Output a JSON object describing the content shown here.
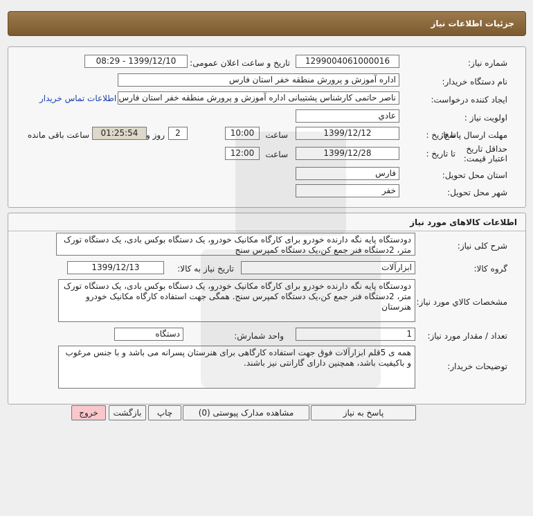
{
  "header": {
    "title": "جزئیات اطلاعات نیاز"
  },
  "need_info": {
    "need_number_label": "شماره نیاز:",
    "need_number": "1299004061000016",
    "announce_label": "تاریخ و ساعت اعلان عمومی:",
    "announce_value": "1399/12/10 - 08:29",
    "buyer_label": "نام دستگاه خریدار:",
    "buyer_value": "اداره آموزش و پرورش منطقه خفر استان فارس",
    "requester_label": "ایجاد کننده درخواست:",
    "requester_value": "ناصر  حاتمی کارشناس پشتیبانی اداره آموزش و پرورش منطقه خفر استان فارس",
    "contact_link": "اطلاعات تماس خریدار",
    "priority_label": "اولویت نیاز :",
    "priority_value": "عادي",
    "deadline_label": "مهلت ارسال پاسخ:",
    "until_date_label": "تا تاریخ :",
    "deadline_date": "1399/12/12",
    "time_label": "ساعت",
    "deadline_time": "10:00",
    "days_value": "2",
    "days_label": "روز و",
    "remaining_time": "01:25:54",
    "remaining_label": "ساعت باقی مانده",
    "validity_label": "حداقل تاریخ اعتبار قیمت:",
    "validity_until_label": "تا تاریخ :",
    "validity_date": "1399/12/28",
    "validity_time_label": "ساعت",
    "validity_time": "12:00",
    "province_label": "استان محل تحویل:",
    "province_value": "فارس",
    "city_label": "شهر محل تحویل:",
    "city_value": "خفر"
  },
  "goods": {
    "section_title": "اطلاعات کالاهای مورد نیاز",
    "summary_label": "شرح کلی نیاز:",
    "summary_value": "دودستگاه پایه نگه دارنده خودرو برای کارگاه مکانیک خودرو، یک دستگاه بوکس بادی، یک دستگاه تورک متر، 2دستگاه فنر جمع کن،یک دستگاه کمپرس سنج",
    "group_label": "گروه کالا:",
    "group_value": "ابزارآلات",
    "need_date_label": "تاریخ نیاز به کالا:",
    "need_date_value": "1399/12/13",
    "specs_label": "مشخصات کالاي مورد نياز:",
    "specs_value": "دودستگاه پایه نگه دارنده خودرو برای کارگاه مکانیک خودرو، یک دستگاه بوکس بادی، یک دستگاه تورک متر، 2دستگاه فنر جمع کن،یک دستگاه کمپرس سنج. همگی جهت استفاده کارگاه مکانیک خودرو هنرستان",
    "qty_label": "تعداد / مقدار مورد نیاز:",
    "qty_value": "1",
    "unit_label": "واحد شمارش:",
    "unit_value": "دستگاه",
    "buyer_notes_label": "توضیحات خریدار:",
    "buyer_notes_value": "همه ی 5قلم ابزارآلات فوق جهت استفاده کارگاهی برای هنرستان پسرانه می باشد و با جنس مرغوب و باکیفیت باشد، همچنین دارای گارانتی نیز باشند."
  },
  "actions": {
    "reply": "پاسخ به نیاز",
    "attachments": "مشاهده مدارک پیوستی (0)",
    "print": "چاپ",
    "back": "بازگشت",
    "exit": "خروج"
  },
  "colors": {
    "header": "#8b6a3e",
    "exit_button": "#f9c7cc",
    "link": "#1a3fb0"
  }
}
